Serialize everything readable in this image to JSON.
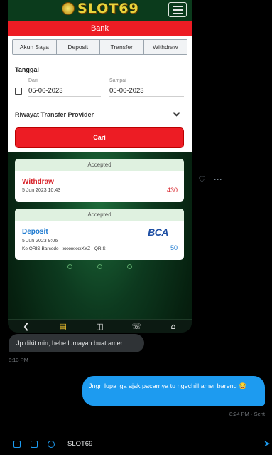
{
  "app": {
    "logo_text": "SLOT69",
    "bank_title": "Bank",
    "tabs": [
      "Akun Saya",
      "Deposit",
      "Transfer",
      "Withdraw"
    ],
    "date_section_label": "Tanggal",
    "from_label": "Dari",
    "from_value": "05-06-2023",
    "to_label": "Sampai",
    "to_value": "05-06-2023",
    "filter_label": "Riwayat Transfer Provider",
    "search_button": "Cari",
    "transactions": [
      {
        "status": "Accepted",
        "type": "Withdraw",
        "datetime": "5 Jun 2023 10:43",
        "amount": "430"
      },
      {
        "status": "Accepted",
        "type": "Deposit",
        "datetime": "5 Jun 2023 9:06",
        "description": "Ke QRIS Barcode - xxxxxxxxXYZ - QRIS",
        "bank": "BCA",
        "amount": "50"
      }
    ],
    "nav_icons": [
      "back-icon",
      "wallet-icon",
      "gift-icon",
      "whatsapp-icon",
      "home-icon"
    ]
  },
  "chat": {
    "incoming_message": "Jp dikit min, hehe lumayan buat amer",
    "incoming_time": "8:13 PM",
    "outgoing_message": "Jngn lupa jga ajak pacarnya tu ngechill amer bareng 😂",
    "outgoing_time": "8:24 PM · Sent",
    "composer_text": "SLOT69"
  },
  "colors": {
    "brand_red": "#ed1c24",
    "chat_blue": "#1d9bf0",
    "accepted_green": "#dff1e0"
  }
}
